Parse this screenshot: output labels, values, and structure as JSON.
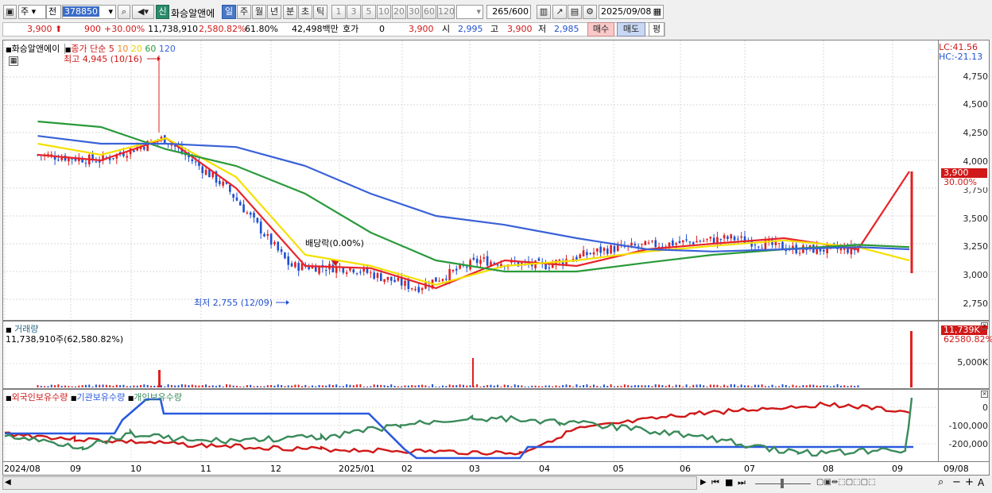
{
  "toolbar": {
    "period_type": "주",
    "prev_label": "전",
    "code": "378850",
    "shin_label": "신",
    "stock_name": "화승알앤에",
    "periods": [
      "일",
      "주",
      "월",
      "년",
      "분",
      "초",
      "틱"
    ],
    "active_period": "일",
    "intervals": [
      "1",
      "3",
      "5",
      "10",
      "20",
      "30",
      "60",
      "120"
    ],
    "count": "265",
    "count_total": "/600",
    "date": "2025/09/08"
  },
  "quote": {
    "price": "3,900",
    "change": "900",
    "change_pct": "+30.00%",
    "volume": "11,738,910",
    "volume_ratio": "2,580.82%",
    "turnover": "61.80%",
    "trade_value": "42,498백만",
    "hoga_label": "호가",
    "hoga_value": "0",
    "hoga_price": "3,900",
    "open_label": "시",
    "open": "2,995",
    "high_label": "고",
    "high": "3,900",
    "low_label": "저",
    "low": "2,985",
    "buy_label": "매수",
    "sell_label": "매도",
    "eval_label": "평"
  },
  "price_pane": {
    "title": "화승알앤에이",
    "ma_label": "종가 단순",
    "ma_periods": [
      {
        "period": "5",
        "color": "#e8242a"
      },
      {
        "period": "10",
        "color": "#f08a24"
      },
      {
        "period": "20",
        "color": "#f4e000"
      },
      {
        "period": "60",
        "color": "#2a9a3a"
      },
      {
        "period": "120",
        "color": "#3a62d8"
      }
    ],
    "high_note": "최고 4,945 (10/16)",
    "low_note": "최저 2,755 (12/09)",
    "dividend_note": "배당락(0.00%)",
    "lc": "LC:41.56",
    "hc": "HC:-21.13",
    "price_chip": "3,900",
    "pct_chip": "30.00%",
    "y_ticks": [
      "4,750",
      "4,500",
      "4,250",
      "4,000",
      "3,750",
      "3,500",
      "3,250",
      "3,000",
      "2,750"
    ]
  },
  "volume_pane": {
    "title": "거래량",
    "value_text": "11,738,910주(62,580.82%)",
    "chip_value": "11,739K",
    "chip_pct": "62580.82%",
    "y_ticks": [
      "5,000K"
    ]
  },
  "holdings_pane": {
    "legend": [
      {
        "label": "외국인보유수량",
        "color": "#d01818"
      },
      {
        "label": "기관보유수량",
        "color": "#2a5ae0"
      },
      {
        "label": "개인보유수량",
        "color": "#3a8a5a"
      }
    ],
    "y_ticks": [
      "0",
      "-100,000",
      "-200,000"
    ]
  },
  "x_axis": [
    "2024/08",
    "09",
    "10",
    "11",
    "12",
    "2025/01",
    "02",
    "03",
    "04",
    "05",
    "06",
    "07",
    "08",
    "09",
    "09/08"
  ],
  "colors": {
    "up": "#e02020",
    "down": "#2050d0",
    "selected": "#4a78c6"
  },
  "chart_data": {
    "type": "line",
    "title": "화승알앤에이",
    "x": [
      "2024/08",
      "09",
      "10",
      "11",
      "12",
      "2025/01",
      "02",
      "03",
      "04",
      "05",
      "06",
      "07",
      "08",
      "09/08"
    ],
    "series": [
      {
        "name": "종가 단순 5",
        "values": [
          4050,
          4000,
          4200,
          3750,
          3050,
          3030,
          2850,
          3100,
          3050,
          3200,
          3250,
          3300,
          3200,
          3900
        ]
      },
      {
        "name": "20",
        "values": [
          4150,
          4050,
          4200,
          3850,
          3150,
          3050,
          2880,
          3050,
          3100,
          3180,
          3230,
          3280,
          3220,
          3100
        ]
      },
      {
        "name": "60",
        "values": [
          4350,
          4300,
          4100,
          3950,
          3700,
          3350,
          3100,
          3000,
          3000,
          3080,
          3150,
          3200,
          3240,
          3220
        ]
      },
      {
        "name": "120",
        "values": [
          4220,
          4150,
          4150,
          4120,
          3950,
          3700,
          3500,
          3420,
          3300,
          3200,
          3180,
          3200,
          3220,
          3200
        ]
      }
    ],
    "ylim": [
      2650,
      4950
    ],
    "high": {
      "value": 4945,
      "date": "10/16"
    },
    "low": {
      "value": 2755,
      "date": "12/09"
    },
    "last": 3900
  }
}
